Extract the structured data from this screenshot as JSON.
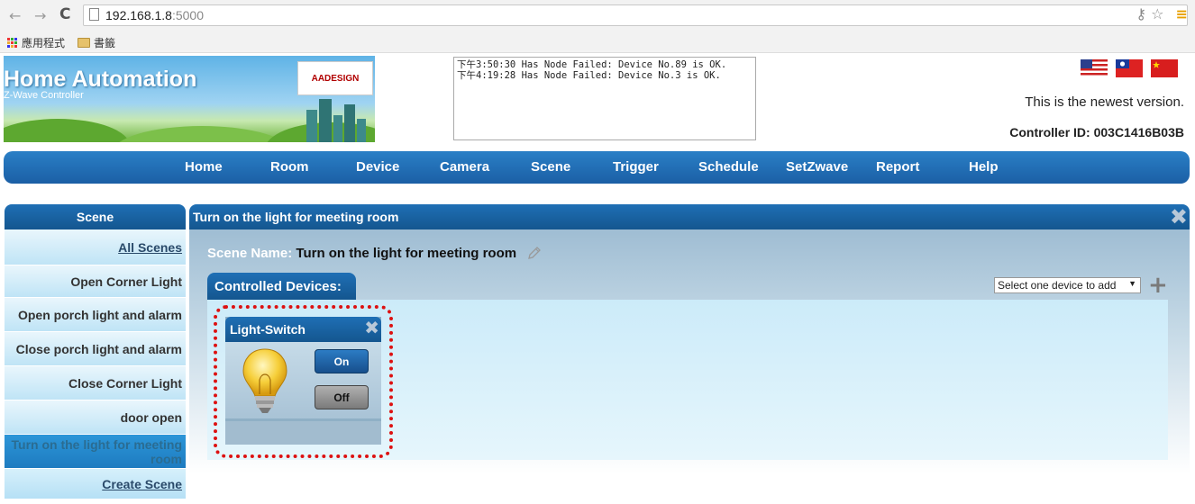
{
  "browser": {
    "url_host": "192.168.1.8",
    "url_port": ":5000",
    "bookmarks": [
      "應用程式",
      "書籤"
    ]
  },
  "header": {
    "title": "Home Automation",
    "subtitle": "Z-Wave Controller",
    "logo_text": "AADESIGN",
    "log": "下午3:50:30 Has Node Failed: Device No.89 is OK.\n下午4:19:28 Has Node Failed: Device No.3 is OK.",
    "version_text": "This is the newest version.",
    "controller_id": "Controller ID: 003C1416B03B"
  },
  "nav": [
    "Home",
    "Room",
    "Device",
    "Camera",
    "Scene",
    "Trigger",
    "Schedule",
    "SetZwave",
    "Report",
    "Help"
  ],
  "sidebar": {
    "title": "Scene",
    "items": [
      {
        "label": "All Scenes"
      },
      {
        "label": "Open Corner Light"
      },
      {
        "label": "Open porch light and alarm"
      },
      {
        "label": "Close porch light and alarm"
      },
      {
        "label": "Close Corner Light"
      },
      {
        "label": "door open"
      },
      {
        "label": "Turn on the light for meeting room"
      },
      {
        "label": "Create Scene"
      }
    ]
  },
  "panel": {
    "title": "Turn on the light for meeting room",
    "scene_name_label": "Scene Name:",
    "scene_name": "Turn on the light for meeting room",
    "controlled_devices_label": "Controlled Devices:",
    "add_device_select": "Select one device to add",
    "device": {
      "name": "Light-Switch",
      "on_label": "On",
      "off_label": "Off"
    }
  },
  "colors": {
    "nav_blue": "#1b5fa5",
    "highlight_red": "#dd1111"
  }
}
